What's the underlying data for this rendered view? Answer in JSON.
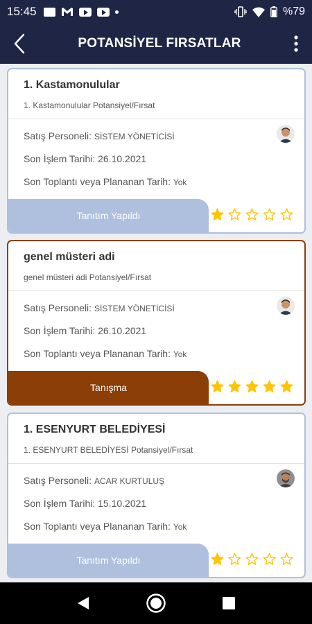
{
  "status_bar": {
    "time": "15:45",
    "battery": "%79",
    "left_icons": [
      "image-icon",
      "gmail-icon",
      "youtube-icon",
      "youtube-icon",
      "dot-icon"
    ],
    "right_icons": [
      "vibrate-icon",
      "wifi-icon",
      "battery-icon"
    ]
  },
  "app_bar": {
    "title": "POTANSİYEL FIRSATLAR",
    "back_icon": "back-arrow-icon",
    "menu_icon": "more-vert-icon"
  },
  "labels": {
    "sales_person": "Satış Personeli: ",
    "last_action_date": "Son İşlem Tarihi: ",
    "last_meeting": "Son Toplantı veya Plananan Tarih: "
  },
  "colors": {
    "header_bg": "#1f2544",
    "stage_blue": "#aec0dd",
    "stage_brown": "#8b3e06",
    "star_yellow": "#ffc400"
  },
  "cards": [
    {
      "title": "1. Kastamonulular",
      "subtitle": "1. Kastamonulular Potansiyel/Fırsat",
      "sales_person": "SİSTEM YÖNETİCİSİ",
      "last_action_date": "26.10.2021",
      "last_meeting": "Yok",
      "stage": "Tanıtım Yapıldı",
      "rating": 1,
      "selected": false
    },
    {
      "title": "genel müsteri adi",
      "subtitle": "genel müsteri adi Potansiyel/Fırsat",
      "sales_person": "SİSTEM YÖNETİCİSİ",
      "last_action_date": "26.10.2021",
      "last_meeting": "Yok",
      "stage": "Tanışma",
      "rating": 5,
      "selected": true
    },
    {
      "title": "1. ESENYURT BELEDİYESİ",
      "subtitle": "1. ESENYURT BELEDİYESİ Potansiyel/Fırsat",
      "sales_person": "ACAR KURTULUŞ",
      "last_action_date": "15.10.2021",
      "last_meeting": "Yok",
      "stage": "Tanıtım Yapıldı",
      "rating": 1,
      "selected": false
    }
  ],
  "nav_bar": [
    "back-triangle-icon",
    "home-circle-icon",
    "recents-square-icon"
  ]
}
